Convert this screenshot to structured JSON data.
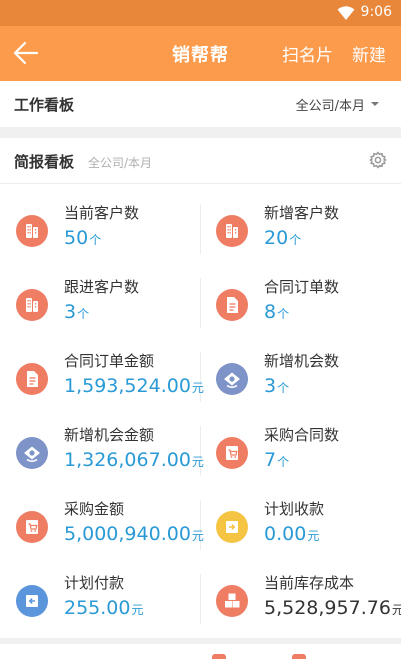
{
  "status_bar": {
    "time": "9:06",
    "wifi_icon": "wifi-icon"
  },
  "app_bar": {
    "title": "销帮帮",
    "scan_label": "扫名片",
    "new_label": "新建",
    "back_icon": "back-arrow-icon"
  },
  "work_board": {
    "title": "工作看板",
    "scope": "全公司/本月"
  },
  "brief_board": {
    "title": "简报看板",
    "scope": "全公司/本月",
    "settings_icon": "gear-icon"
  },
  "metrics": [
    {
      "label": "当前客户数",
      "value": "50",
      "unit": "个",
      "icon": "building-icon",
      "color": "#ef7d63"
    },
    {
      "label": "新增客户数",
      "value": "20",
      "unit": "个",
      "icon": "building-icon",
      "color": "#ef7d63"
    },
    {
      "label": "跟进客户数",
      "value": "3",
      "unit": "个",
      "icon": "building-icon",
      "color": "#ef7d63"
    },
    {
      "label": "合同订单数",
      "value": "8",
      "unit": "个",
      "icon": "document-icon",
      "color": "#ef7d63"
    },
    {
      "label": "合同订单金额",
      "value": "1,593,524.00",
      "unit": "元",
      "icon": "document-icon",
      "color": "#ef7d63"
    },
    {
      "label": "新增机会数",
      "value": "3",
      "unit": "个",
      "icon": "opportunity-icon",
      "color": "#7e94c8"
    },
    {
      "label": "新增机会金额",
      "value": "1,326,067.00",
      "unit": "元",
      "icon": "opportunity-icon",
      "color": "#7e94c8"
    },
    {
      "label": "采购合同数",
      "value": "7",
      "unit": "个",
      "icon": "cart-icon",
      "color": "#ef7d63"
    },
    {
      "label": "采购金额",
      "value": "5,000,940.00",
      "unit": "元",
      "icon": "cart-icon",
      "color": "#ef7d63"
    },
    {
      "label": "计划收款",
      "value": "0.00",
      "unit": "元",
      "icon": "receive-icon",
      "color": "#f5c443"
    },
    {
      "label": "计划付款",
      "value": "255.00",
      "unit": "元",
      "icon": "payment-icon",
      "color": "#5b95dc"
    },
    {
      "label": "当前库存成本",
      "value": "5,528,957.76",
      "unit": "元",
      "icon": "boxes-icon",
      "color": "#ef7d63"
    }
  ]
}
